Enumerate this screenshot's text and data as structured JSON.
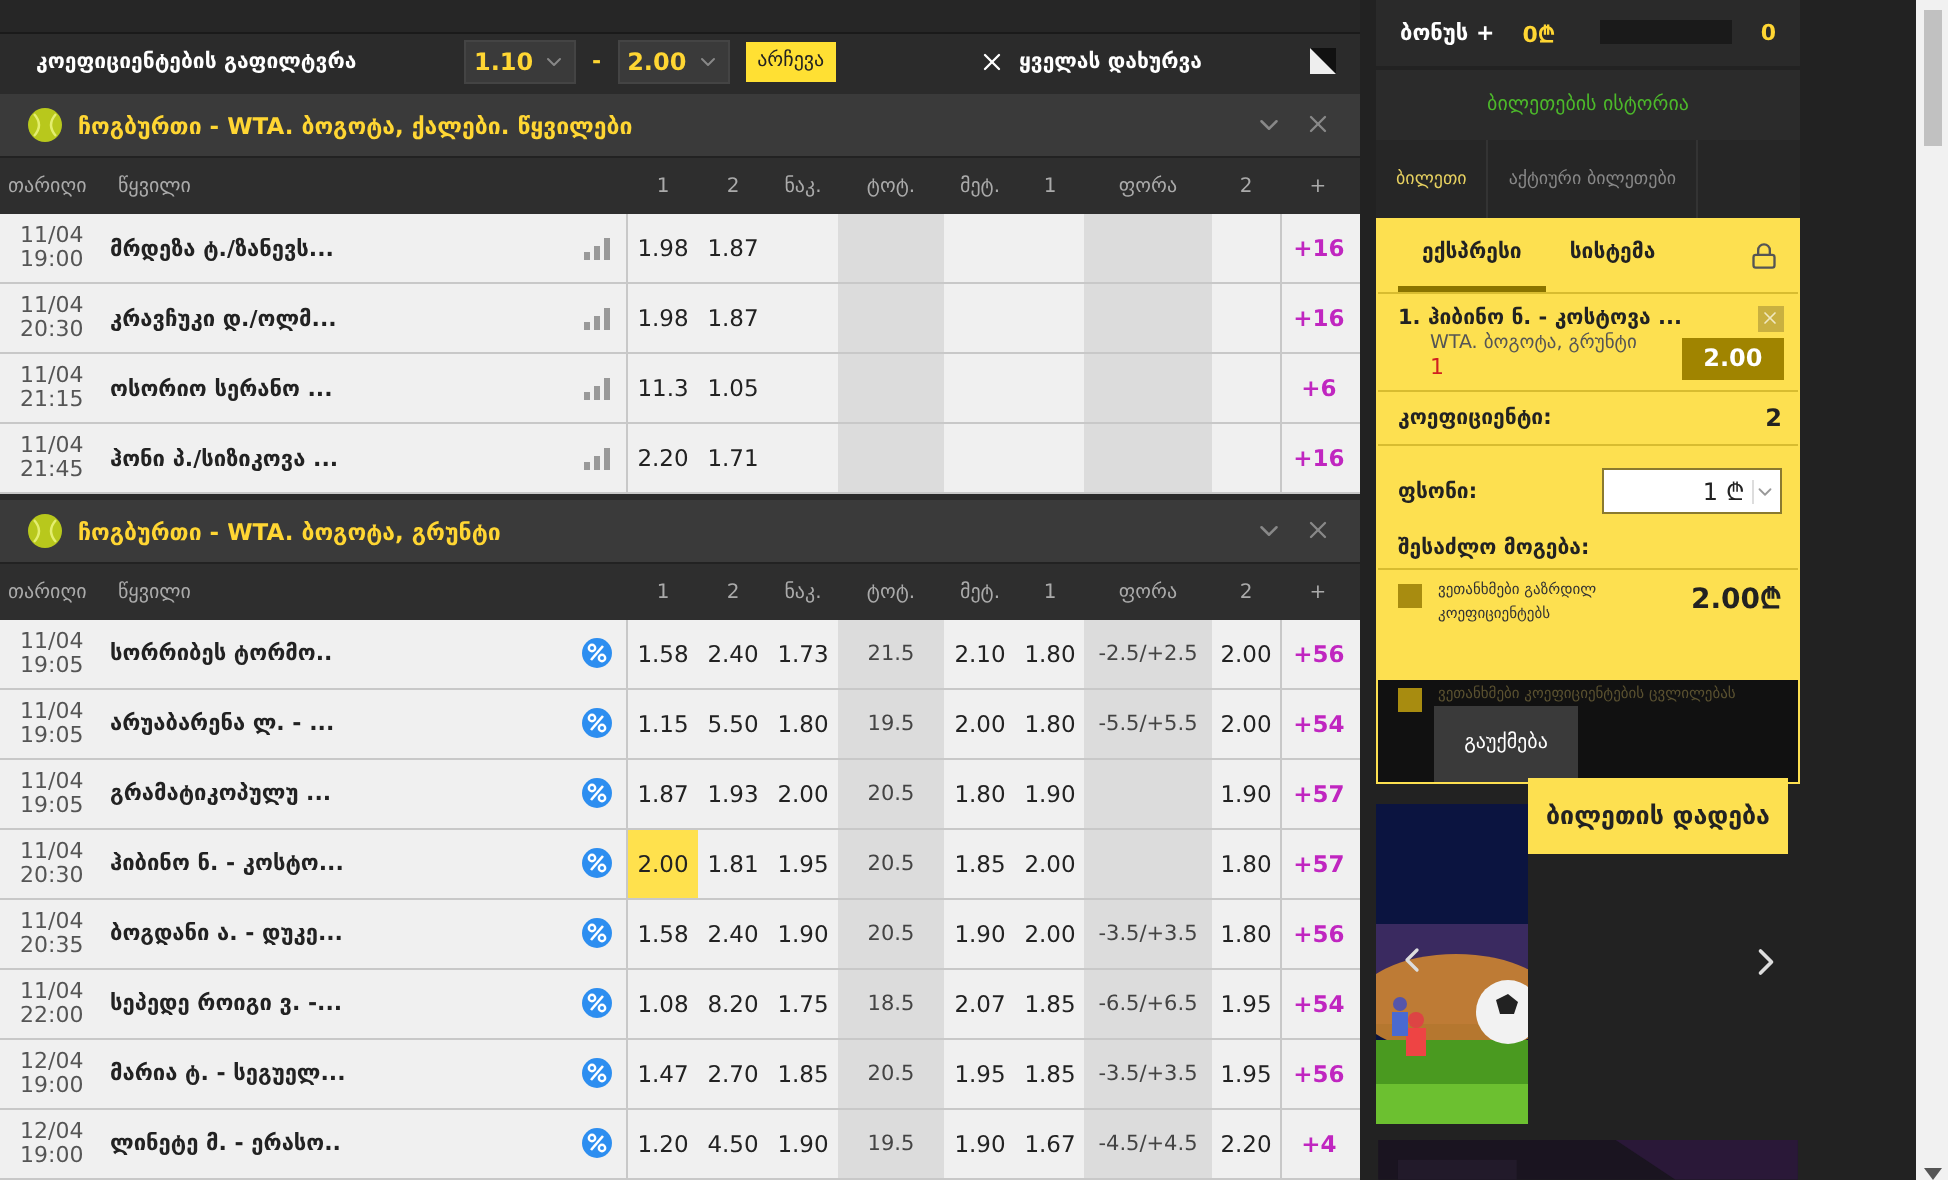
{
  "filter": {
    "title": "კოეფიციენტების გაფილტვრა",
    "from": "1.10",
    "separator": "-",
    "to": "2.00",
    "apply": "არჩევა",
    "close_all": "ყველას დახურვა"
  },
  "sections": [
    {
      "title": "ჩოგბურთი - WTA. ბოგოტა, ქალები. წყვილები",
      "expanded": true,
      "columns": [
        "თარიღი",
        "წყვილი",
        "1",
        "2",
        "ნაკ.",
        "ტოტ.",
        "მეტ.",
        "1",
        "ფორა",
        "2",
        "+"
      ],
      "rows": [
        {
          "date": "11/04",
          "time": "19:00",
          "name": "მრდეზა ტ./ზანევს...",
          "kind": "chart",
          "odds": [
            {
              "kind": "odds",
              "value": "1.98",
              "selected": false
            },
            {
              "kind": "odds",
              "value": "1.87",
              "selected": false
            },
            {
              "kind": "empty"
            },
            {
              "kind": "empty"
            },
            {
              "kind": "empty"
            },
            {
              "kind": "empty"
            },
            {
              "kind": "empty"
            },
            {
              "kind": "empty"
            }
          ],
          "more": "+16"
        },
        {
          "date": "11/04",
          "time": "20:30",
          "name": "კრავჩუკი დ./ოლმ...",
          "kind": "chart",
          "odds": [
            {
              "kind": "odds",
              "value": "1.98",
              "selected": false
            },
            {
              "kind": "odds",
              "value": "1.87",
              "selected": false
            },
            {
              "kind": "empty"
            },
            {
              "kind": "empty"
            },
            {
              "kind": "empty"
            },
            {
              "kind": "empty"
            },
            {
              "kind": "empty"
            },
            {
              "kind": "empty"
            }
          ],
          "more": "+16"
        },
        {
          "date": "11/04",
          "time": "21:15",
          "name": "ოსორიო სერანო ...",
          "kind": "chart",
          "odds": [
            {
              "kind": "odds",
              "value": "11.3",
              "selected": false
            },
            {
              "kind": "odds",
              "value": "1.05",
              "selected": false
            },
            {
              "kind": "empty"
            },
            {
              "kind": "empty"
            },
            {
              "kind": "empty"
            },
            {
              "kind": "empty"
            },
            {
              "kind": "empty"
            },
            {
              "kind": "empty"
            }
          ],
          "more": "+6"
        },
        {
          "date": "11/04",
          "time": "21:45",
          "name": "ჰონი პ./სიზიკოვა ...",
          "kind": "chart",
          "odds": [
            {
              "kind": "odds",
              "value": "2.20",
              "selected": false
            },
            {
              "kind": "odds",
              "value": "1.71",
              "selected": false
            },
            {
              "kind": "empty"
            },
            {
              "kind": "empty"
            },
            {
              "kind": "empty"
            },
            {
              "kind": "empty"
            },
            {
              "kind": "empty"
            },
            {
              "kind": "empty"
            }
          ],
          "more": "+16"
        }
      ]
    },
    {
      "title": "ჩოგბურთი - WTA. ბოგოტა, გრუნტი",
      "expanded": true,
      "columns": [
        "თარიღი",
        "წყვილი",
        "1",
        "2",
        "ნაკ.",
        "ტოტ.",
        "მეტ.",
        "1",
        "ფორა",
        "2",
        "+"
      ],
      "rows": [
        {
          "date": "11/04",
          "time": "19:05",
          "name": "სორრიბეს ტორმო..",
          "kind": "percent",
          "odds": [
            {
              "kind": "odds",
              "value": "1.58",
              "selected": false
            },
            {
              "kind": "odds",
              "value": "2.40",
              "selected": false
            },
            {
              "kind": "odds",
              "value": "1.73",
              "selected": false
            },
            {
              "kind": "odds",
              "value": "21.5",
              "selected": false
            },
            {
              "kind": "odds",
              "value": "2.10",
              "selected": false
            },
            {
              "kind": "odds",
              "value": "1.80",
              "selected": false
            },
            {
              "kind": "odds",
              "value": "-2.5/+2.5",
              "selected": false
            },
            {
              "kind": "odds",
              "value": "2.00",
              "selected": false
            }
          ],
          "more": "+56"
        },
        {
          "date": "11/04",
          "time": "19:05",
          "name": "არუაბარენა ლ. - ...",
          "kind": "percent",
          "odds": [
            {
              "kind": "odds",
              "value": "1.15",
              "selected": false
            },
            {
              "kind": "odds",
              "value": "5.50",
              "selected": false
            },
            {
              "kind": "odds",
              "value": "1.80",
              "selected": false
            },
            {
              "kind": "odds",
              "value": "19.5",
              "selected": false
            },
            {
              "kind": "odds",
              "value": "2.00",
              "selected": false
            },
            {
              "kind": "odds",
              "value": "1.80",
              "selected": false
            },
            {
              "kind": "odds",
              "value": "-5.5/+5.5",
              "selected": false
            },
            {
              "kind": "odds",
              "value": "2.00",
              "selected": false
            }
          ],
          "more": "+54"
        },
        {
          "date": "11/04",
          "time": "19:05",
          "name": "გრამატიკოპულუ ...",
          "kind": "percent",
          "odds": [
            {
              "kind": "odds",
              "value": "1.87",
              "selected": false
            },
            {
              "kind": "odds",
              "value": "1.93",
              "selected": false
            },
            {
              "kind": "odds",
              "value": "2.00",
              "selected": false
            },
            {
              "kind": "odds",
              "value": "20.5",
              "selected": false
            },
            {
              "kind": "odds",
              "value": "1.80",
              "selected": false
            },
            {
              "kind": "odds",
              "value": "1.90",
              "selected": false
            },
            {
              "kind": "empty"
            },
            {
              "kind": "odds",
              "value": "1.90",
              "selected": false
            }
          ],
          "more": "+57"
        },
        {
          "date": "11/04",
          "time": "20:30",
          "name": "ჰიბინო ნ. - კოსტო...",
          "kind": "percent",
          "odds": [
            {
              "kind": "odds",
              "value": "2.00",
              "selected": true
            },
            {
              "kind": "odds",
              "value": "1.81",
              "selected": false
            },
            {
              "kind": "odds",
              "value": "1.95",
              "selected": false
            },
            {
              "kind": "odds",
              "value": "20.5",
              "selected": false
            },
            {
              "kind": "odds",
              "value": "1.85",
              "selected": false
            },
            {
              "kind": "odds",
              "value": "2.00",
              "selected": false
            },
            {
              "kind": "empty"
            },
            {
              "kind": "odds",
              "value": "1.80",
              "selected": false
            }
          ],
          "more": "+57"
        },
        {
          "date": "11/04",
          "time": "20:35",
          "name": "ბოგდანი ა. - დუკე...",
          "kind": "percent",
          "odds": [
            {
              "kind": "odds",
              "value": "1.58",
              "selected": false
            },
            {
              "kind": "odds",
              "value": "2.40",
              "selected": false
            },
            {
              "kind": "odds",
              "value": "1.90",
              "selected": false
            },
            {
              "kind": "odds",
              "value": "20.5",
              "selected": false
            },
            {
              "kind": "odds",
              "value": "1.90",
              "selected": false
            },
            {
              "kind": "odds",
              "value": "2.00",
              "selected": false
            },
            {
              "kind": "odds",
              "value": "-3.5/+3.5",
              "selected": false
            },
            {
              "kind": "odds",
              "value": "1.80",
              "selected": false
            }
          ],
          "more": "+56"
        },
        {
          "date": "11/04",
          "time": "22:00",
          "name": "სეპედე როიგი ვ. -...",
          "kind": "percent",
          "odds": [
            {
              "kind": "odds",
              "value": "1.08",
              "selected": false
            },
            {
              "kind": "odds",
              "value": "8.20",
              "selected": false
            },
            {
              "kind": "odds",
              "value": "1.75",
              "selected": false
            },
            {
              "kind": "odds",
              "value": "18.5",
              "selected": false
            },
            {
              "kind": "odds",
              "value": "2.07",
              "selected": false
            },
            {
              "kind": "odds",
              "value": "1.85",
              "selected": false
            },
            {
              "kind": "odds",
              "value": "-6.5/+6.5",
              "selected": false
            },
            {
              "kind": "odds",
              "value": "1.95",
              "selected": false
            }
          ],
          "more": "+54"
        },
        {
          "date": "12/04",
          "time": "19:00",
          "name": "მარია ტ. - სეგუელ...",
          "kind": "percent",
          "odds": [
            {
              "kind": "odds",
              "value": "1.47",
              "selected": false
            },
            {
              "kind": "odds",
              "value": "2.70",
              "selected": false
            },
            {
              "kind": "odds",
              "value": "1.85",
              "selected": false
            },
            {
              "kind": "odds",
              "value": "20.5",
              "selected": false
            },
            {
              "kind": "odds",
              "value": "1.95",
              "selected": false
            },
            {
              "kind": "odds",
              "value": "1.85",
              "selected": false
            },
            {
              "kind": "odds",
              "value": "-3.5/+3.5",
              "selected": false
            },
            {
              "kind": "odds",
              "value": "1.95",
              "selected": false
            }
          ],
          "more": "+56"
        },
        {
          "date": "12/04",
          "time": "19:00",
          "name": "ლინეტე მ. - ერასო..",
          "kind": "percent",
          "odds": [
            {
              "kind": "odds",
              "value": "1.20",
              "selected": false
            },
            {
              "kind": "odds",
              "value": "4.50",
              "selected": false
            },
            {
              "kind": "odds",
              "value": "1.90",
              "selected": false
            },
            {
              "kind": "odds",
              "value": "19.5",
              "selected": false
            },
            {
              "kind": "odds",
              "value": "1.90",
              "selected": false
            },
            {
              "kind": "odds",
              "value": "1.67",
              "selected": false
            },
            {
              "kind": "odds",
              "value": "-4.5/+4.5",
              "selected": false
            },
            {
              "kind": "odds",
              "value": "2.20",
              "selected": false
            }
          ],
          "more": "+4"
        }
      ]
    }
  ],
  "bonus": {
    "label": "ბონუს +",
    "amount": "0₾",
    "level": 0,
    "count": "0"
  },
  "history": "ბილეთების ისტორია",
  "ticket_tabs": [
    {
      "label": "ბილეთი",
      "selected": true
    },
    {
      "label": "აქტიური ბილეთები",
      "selected": false
    }
  ],
  "bet_types": [
    {
      "label": "ექსპრესი",
      "selected": true
    },
    {
      "label": "სისტემა",
      "selected": false
    }
  ],
  "selection": {
    "title": "1. ჰიბინო ნ. - კოსტოვა ...",
    "league": "WTA. ბოგოტა, გრუნტი",
    "outcome": "1",
    "odds": "2.00"
  },
  "coefficient": {
    "label": "კოეფიციენტი:",
    "value": "2"
  },
  "stake": {
    "label": "ფსონი:",
    "value": "1",
    "currency": "₾"
  },
  "possible_win": {
    "label": "შესაძლო მოგება:",
    "value": "2.00₾"
  },
  "agreements": [
    {
      "label": "ვეთანხმები გაზრდილ კოეფიციენტებს",
      "checked": false
    },
    {
      "label": "ვეთანხმები კოეფიციენტების ცვლილებას",
      "checked": false
    }
  ],
  "cancel": "გაუქმება",
  "place_bet": "ბილეთის დადება"
}
